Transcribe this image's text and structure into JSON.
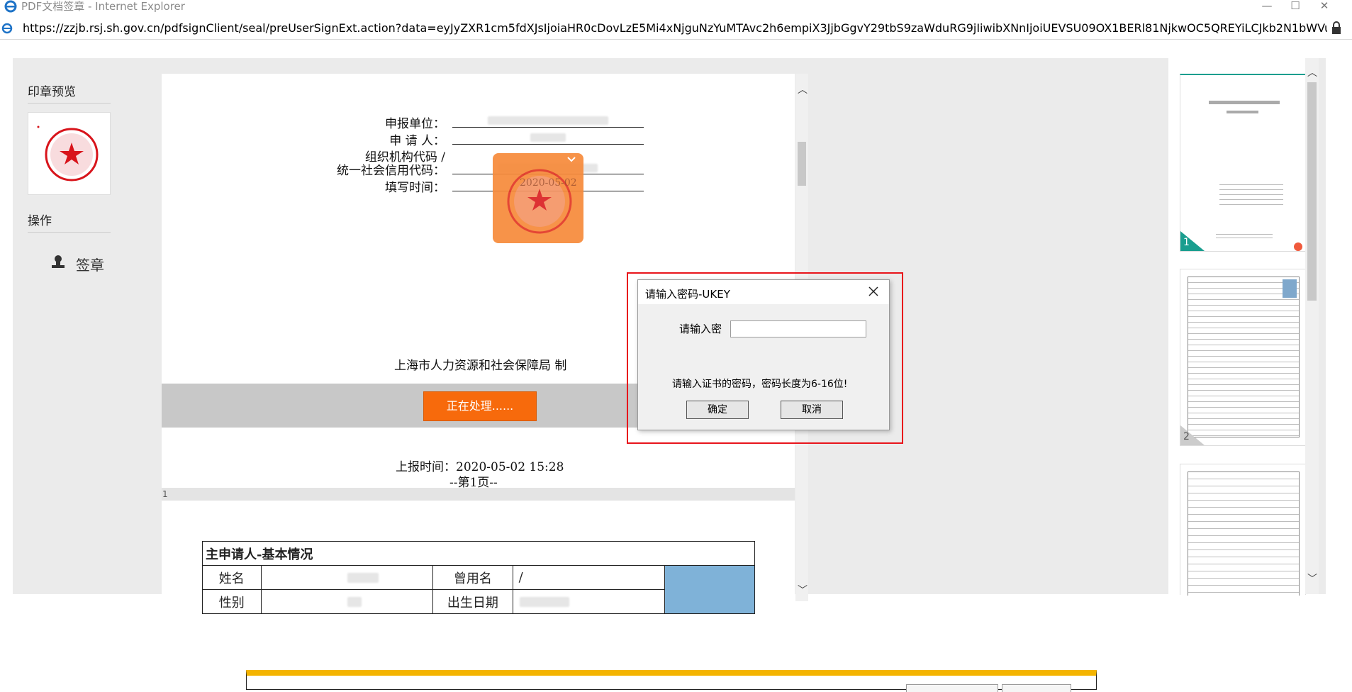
{
  "window": {
    "title": "PDF文档签章 - Internet Explorer",
    "url": "https://zzjb.rsj.sh.gov.cn/pdfsignClient/seal/preUserSignExt.action?data=eyJyZXR1cm5fdXJsIjoiaHR0cDovLzE5Mi4xNjguNzYuMTAvc2h6empiX3JjbGgvY29tbS9zaWduRG9jIiwibXNnIjoiUEVSU09OX1BERl81NjkwOC5QREYiLCJkb2N1bWVudF9ubyI6IlBFUlNPTiI"
  },
  "left_panel": {
    "seal_preview_title": "印章预览",
    "actions_title": "操作",
    "sign_label": "签章"
  },
  "document": {
    "fields": [
      {
        "label": "申报单位："
      },
      {
        "label": "申 请 人："
      },
      {
        "label_line1": "组织机构代码 /",
        "label": "统一社会信用代码："
      },
      {
        "label": "填写时间："
      }
    ],
    "stamp_date": "2020-05-02",
    "issuer": "上海市人力资源和社会保障局 制",
    "processing_button": "正在处理......",
    "report_time": "上报时间：2020-05-02 15:28",
    "page_footer": "--第1页--",
    "page_number": "1",
    "table": {
      "heading": "主申请人-基本情况",
      "rows": [
        [
          "姓名",
          "",
          "曾用名",
          "/"
        ],
        [
          "性别",
          "",
          "出生日期",
          ""
        ]
      ]
    }
  },
  "thumbnails": [
    {
      "number": "1"
    },
    {
      "number": "2"
    },
    {
      "number": ""
    }
  ],
  "dialog": {
    "title": "请输入密码-UKEY",
    "password_label": "请输入密",
    "password_value": "",
    "hint": "请输入证书的密码，密码长度为6-16位!",
    "ok_label": "确定",
    "cancel_label": "取消"
  },
  "colors": {
    "accent_orange": "#f76a0c",
    "highlight_red": "#e8141b",
    "thumb_teal": "#1a9e8f"
  }
}
